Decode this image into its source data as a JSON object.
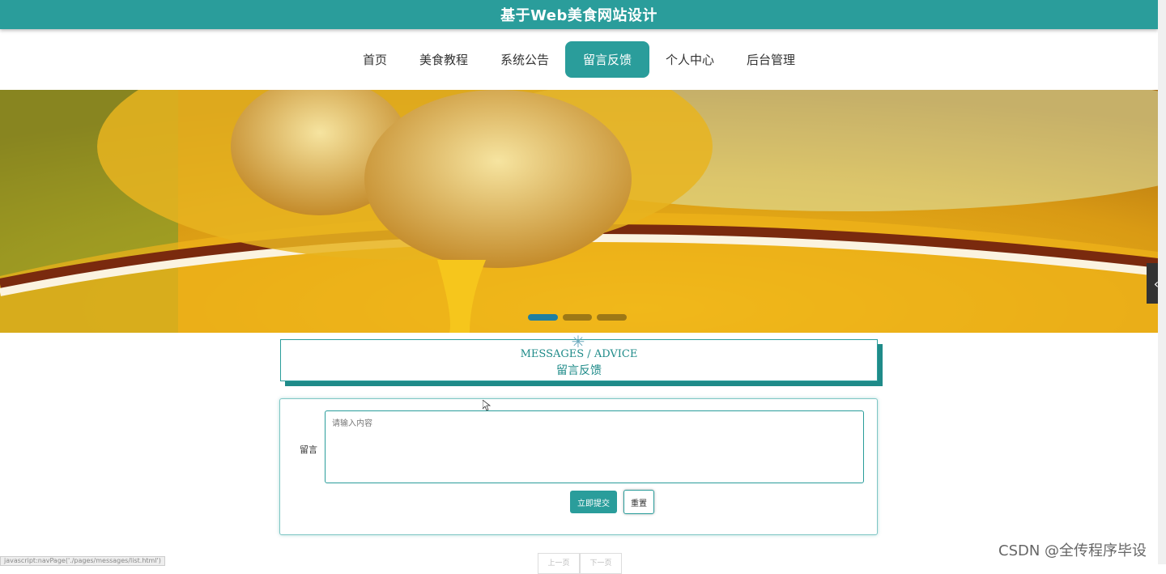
{
  "header": {
    "title": "基于Web美食网站设计"
  },
  "nav": {
    "items": [
      "首页",
      "美食教程",
      "系统公告",
      "留言反馈",
      "个人中心",
      "后台管理"
    ],
    "active_index": 3
  },
  "banner": {
    "slide_indicator": {
      "count": 3,
      "active": 0
    }
  },
  "section": {
    "title_en": "MESSAGES / ADVICE",
    "title_zh": "留言反馈"
  },
  "form": {
    "label": "留言",
    "textarea_placeholder": "请输入内容",
    "submit_label": "立即提交",
    "reset_label": "重置"
  },
  "pager": {
    "prev_label": "上一页",
    "next_label": "下一页"
  },
  "status_bar": {
    "text": "javascript:navPage('./pages/messages/list.html')"
  },
  "watermark": "CSDN @全传程序毕设",
  "colors": {
    "accent": "#2a9d9b",
    "accent_dark": "#1f8b89"
  },
  "icons": {
    "side_arrow": "chevron-left-icon",
    "loading": "spinner-icon"
  }
}
